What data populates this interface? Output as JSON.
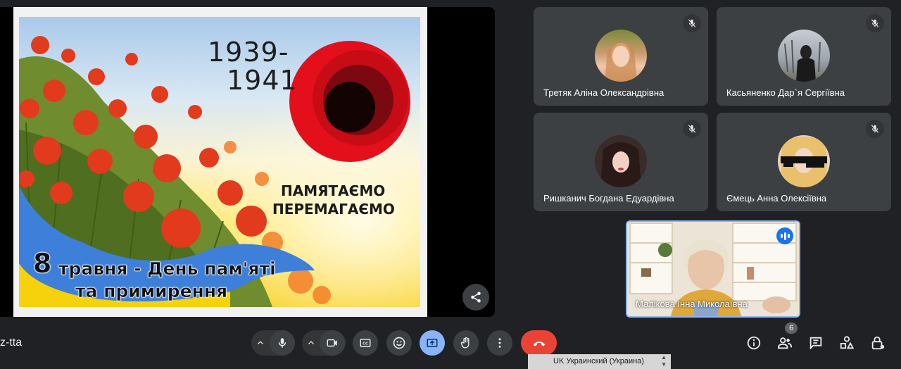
{
  "slide": {
    "year_line1": "1939-",
    "year_line2": "1941",
    "motto_line1": "ПАМЯТАЄМО",
    "motto_line2": "ПЕРЕМАГАЄМО",
    "date_number": "8",
    "date_rest": "травня - День пам'яті",
    "date_line2": "та примирення"
  },
  "participants": [
    {
      "name": "Третяк Аліна Олександрівна"
    },
    {
      "name": "Касьяненко Дар`я Сергіївна"
    },
    {
      "name": "Ришканич Богдана Едуардівна"
    },
    {
      "name": "Ємець Анна Олексіївна"
    }
  ],
  "active_speaker": {
    "name": "Малікова Інна Миколаївна"
  },
  "meeting": {
    "code_fragment": "z-tta"
  },
  "controls": {
    "participants_count": "6"
  },
  "language_bar": {
    "label": "UK Украинский (Украина)"
  },
  "colors": {
    "background": "#202124",
    "tile": "#3c4043",
    "accent": "#8ab4f8",
    "end_call": "#ea4335"
  },
  "icons": [
    "share-icon",
    "mic-off-icon",
    "mic-icon",
    "camera-icon",
    "chevron-up-icon",
    "captions-icon",
    "emoji-icon",
    "present-icon",
    "hand-icon",
    "more-icon",
    "end-call-icon",
    "info-icon",
    "people-icon",
    "chat-icon",
    "activities-icon",
    "host-controls-icon"
  ]
}
